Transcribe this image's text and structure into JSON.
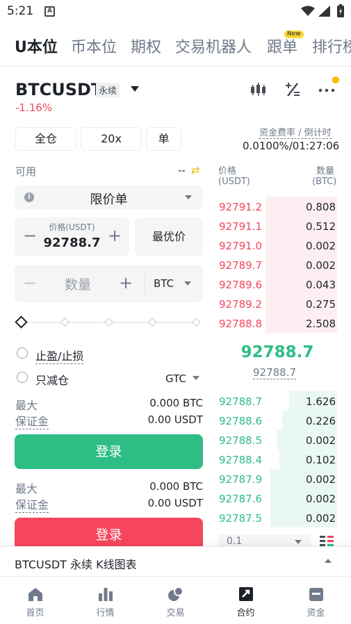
{
  "status_bar": {
    "time": "5:21",
    "app_icon_letter": "A"
  },
  "top_nav": {
    "tabs": [
      {
        "label": "U本位",
        "active": true
      },
      {
        "label": "币本位"
      },
      {
        "label": "期权"
      },
      {
        "label": "交易机器人"
      },
      {
        "label": "跟单"
      },
      {
        "label": "排行榜"
      }
    ],
    "new_badge": "New"
  },
  "header": {
    "symbol": "BTCUSDT",
    "contract_type": "永续",
    "change_pct": "-1.16%"
  },
  "margin": {
    "mode": "全仓",
    "leverage": "20x",
    "position_mode": "单"
  },
  "funding": {
    "label": "资金费率 / 倒计时",
    "value": "0.0100%/01:27:06"
  },
  "available": {
    "label": "可用",
    "value": "--"
  },
  "order_form": {
    "order_type": "限价单",
    "price_label": "价格(USDT)",
    "price_value": "92788.7",
    "best_price_label": "最优价",
    "qty_placeholder": "数量",
    "qty_unit": "BTC",
    "minus": "−",
    "plus": "+",
    "slider_percent": 0,
    "tp_sl_label": "止盈/止损",
    "reduce_only_label": "只减仓",
    "time_in_force": "GTC"
  },
  "buy_panel": {
    "max_label": "最大",
    "max_value": "0.000 BTC",
    "margin_label": "保证金",
    "margin_value": "0.00 USDT",
    "button": "登录"
  },
  "sell_panel": {
    "max_label": "最大",
    "max_value": "0.000 BTC",
    "margin_label": "保证金",
    "margin_value": "0.00 USDT",
    "button": "登录"
  },
  "order_book": {
    "price_header": "价格",
    "price_unit": "(USDT)",
    "qty_header": "数量",
    "qty_unit": "(BTC)",
    "asks": [
      {
        "price": "92791.2",
        "qty": "0.808",
        "depth": 0.6
      },
      {
        "price": "92791.1",
        "qty": "0.512",
        "depth": 0.6
      },
      {
        "price": "92791.0",
        "qty": "0.002",
        "depth": 0.6
      },
      {
        "price": "92789.7",
        "qty": "0.002",
        "depth": 0.6
      },
      {
        "price": "92789.6",
        "qty": "0.043",
        "depth": 0.6
      },
      {
        "price": "92789.2",
        "qty": "0.275",
        "depth": 0.6
      },
      {
        "price": "92788.8",
        "qty": "2.508",
        "depth": 0.6
      }
    ],
    "last_price": "92788.7",
    "mark_price": "92788.7",
    "bids": [
      {
        "price": "92788.7",
        "qty": "1.626",
        "depth": 0.4
      },
      {
        "price": "92788.6",
        "qty": "0.226",
        "depth": 0.46
      },
      {
        "price": "92788.5",
        "qty": "0.002",
        "depth": 0.5
      },
      {
        "price": "92788.4",
        "qty": "0.102",
        "depth": 0.48
      },
      {
        "price": "92787.9",
        "qty": "0.002",
        "depth": 0.56
      },
      {
        "price": "92787.6",
        "qty": "0.002",
        "depth": 0.56
      },
      {
        "price": "92787.5",
        "qty": "0.002",
        "depth": 0.56
      }
    ],
    "depth_step": "0.1"
  },
  "kline_bar": {
    "label": "BTCUSDT 永续 K线图表"
  },
  "bottom_nav": [
    {
      "label": "首页",
      "icon": "home-icon"
    },
    {
      "label": "行情",
      "icon": "markets-icon"
    },
    {
      "label": "交易",
      "icon": "trade-icon"
    },
    {
      "label": "合约",
      "icon": "futures-icon",
      "active": true
    },
    {
      "label": "资金",
      "icon": "wallet-icon"
    }
  ],
  "colors": {
    "up": "#2ebd85",
    "down": "#f6465d",
    "accent": "#fcd535"
  }
}
